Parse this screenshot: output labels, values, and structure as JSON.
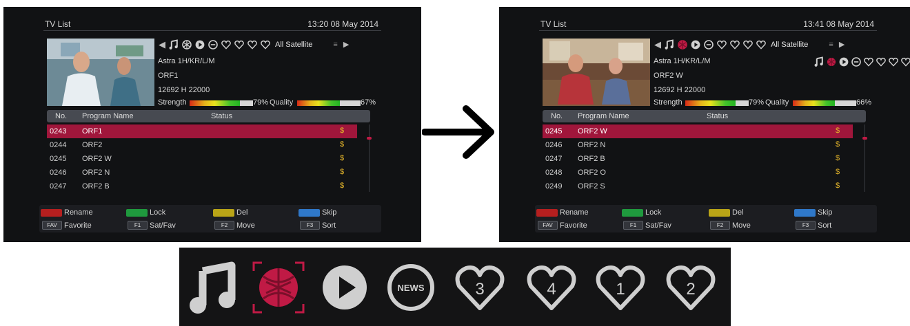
{
  "left_screen": {
    "title": "TV List",
    "datetime": "13:20 08 May 2014",
    "satellite_label": "All Satellite",
    "info": [
      "Astra 1H/KR/L/M",
      "ORF1",
      "12692 H 22000"
    ],
    "strength_label": "Strength",
    "strength_value": "79%",
    "strength_fraction": 0.79,
    "quality_label": "Quality",
    "quality_value": "67%",
    "quality_fraction": 0.67,
    "columns": [
      "No.",
      "Program Name",
      "Status"
    ],
    "rows": [
      {
        "no": "0243",
        "name": "ORF1",
        "selected": true
      },
      {
        "no": "0244",
        "name": "ORF2",
        "selected": false
      },
      {
        "no": "0245",
        "name": "ORF2 W",
        "selected": false
      },
      {
        "no": "0246",
        "name": "ORF2 N",
        "selected": false
      },
      {
        "no": "0247",
        "name": "ORF2 B",
        "selected": false
      }
    ],
    "footer": {
      "rename": "Rename",
      "lock": "Lock",
      "del": "Del",
      "skip": "Skip",
      "fav_key": "FAV",
      "favorite": "Favorite",
      "f1_key": "F1",
      "satfav": "Sat/Fav",
      "f2_key": "F2",
      "move": "Move",
      "f3_key": "F3",
      "sort": "Sort"
    }
  },
  "right_screen": {
    "title": "TV List",
    "datetime": "13:41 08 May 2014",
    "satellite_label": "All Satellite",
    "info": [
      "Astra 1H/KR/L/M",
      "ORF2 W",
      "12692 H 22000"
    ],
    "strength_label": "Strength",
    "strength_value": "79%",
    "strength_fraction": 0.79,
    "quality_label": "Quality",
    "quality_value": "66%",
    "quality_fraction": 0.66,
    "columns": [
      "No.",
      "Program Name",
      "Status"
    ],
    "rows": [
      {
        "no": "0245",
        "name": "ORF2 W",
        "selected": true
      },
      {
        "no": "0246",
        "name": "ORF2 N",
        "selected": false
      },
      {
        "no": "0247",
        "name": "ORF2 B",
        "selected": false
      },
      {
        "no": "0248",
        "name": "ORF2 O",
        "selected": false
      },
      {
        "no": "0249",
        "name": "ORF2 S",
        "selected": false
      }
    ],
    "footer": {
      "rename": "Rename",
      "lock": "Lock",
      "del": "Del",
      "skip": "Skip",
      "fav_key": "FAV",
      "favorite": "Favorite",
      "f1_key": "F1",
      "satfav": "Sat/Fav",
      "f2_key": "F2",
      "move": "Move",
      "f3_key": "F3",
      "sort": "Sort"
    }
  },
  "zoom_strip": {
    "icons": [
      "music-icon",
      "sports-icon",
      "play-icon",
      "news-icon",
      "favorite-3-icon",
      "favorite-4-icon",
      "favorite-1-icon",
      "favorite-2-icon"
    ],
    "news_text": "NEWS",
    "fav_numbers": [
      "3",
      "4",
      "1",
      "2"
    ],
    "active_icon": "sports-icon"
  },
  "colors": {
    "selected_row": "#a0163b",
    "accent_red": "#c01a45",
    "key_red": "#b51f1f",
    "key_green": "#1f9a3e",
    "key_yellow": "#b9a417",
    "key_blue": "#2f78c9"
  }
}
